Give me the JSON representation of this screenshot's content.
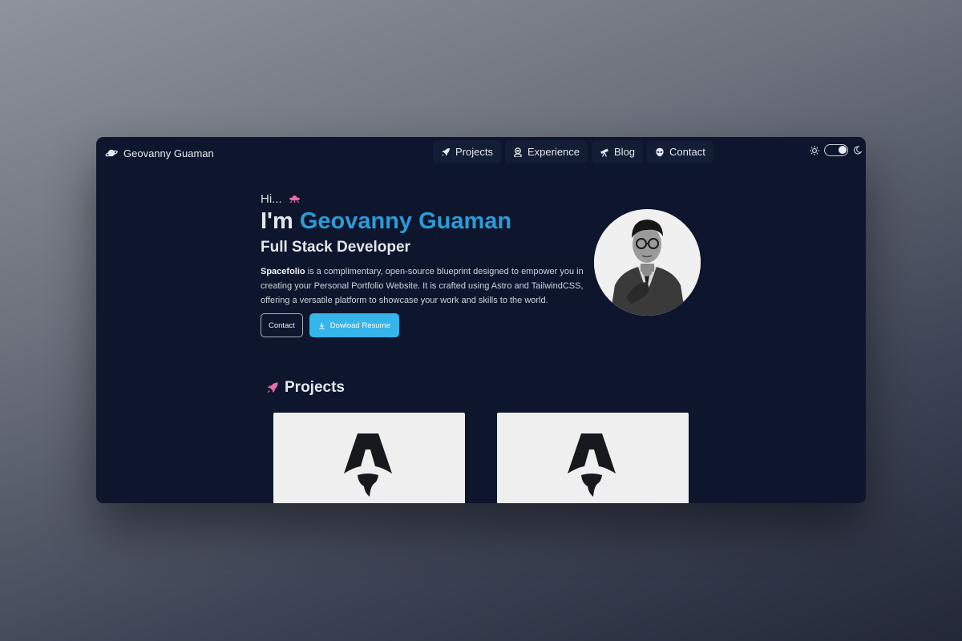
{
  "brand": {
    "name": "Geovanny Guaman",
    "icon": "planet-icon"
  },
  "nav": [
    {
      "label": "Projects",
      "icon": "rocket-icon"
    },
    {
      "label": "Experience",
      "icon": "astronaut-icon"
    },
    {
      "label": "Blog",
      "icon": "telescope-icon"
    },
    {
      "label": "Contact",
      "icon": "alien-icon"
    }
  ],
  "theme": {
    "light_icon": "sun-icon",
    "dark_icon": "moon-icon",
    "mode": "dark"
  },
  "hero": {
    "greeting": "Hi...",
    "greeting_icon": "ufo-icon",
    "im": "I'm",
    "name": "Geovanny Guaman",
    "role": "Full Stack Developer",
    "desc_bold": "Spacefolio",
    "desc_rest": " is a complimentary, open-source blueprint designed to empower you in creating your Personal Portfolio Website. It is crafted using Astro and TailwindCSS, offering a versatile platform to showcase your work and skills to the world.",
    "contact_label": "Contact",
    "resume_label": "Dowload Resume"
  },
  "projects": {
    "title": "Projects",
    "icon": "rocket-icon"
  },
  "colors": {
    "window_bg": "#0d162c",
    "accent_name": "#2c9bd8",
    "primary_button": "#36b5ea",
    "pink_icon": "#ec6aa8"
  }
}
